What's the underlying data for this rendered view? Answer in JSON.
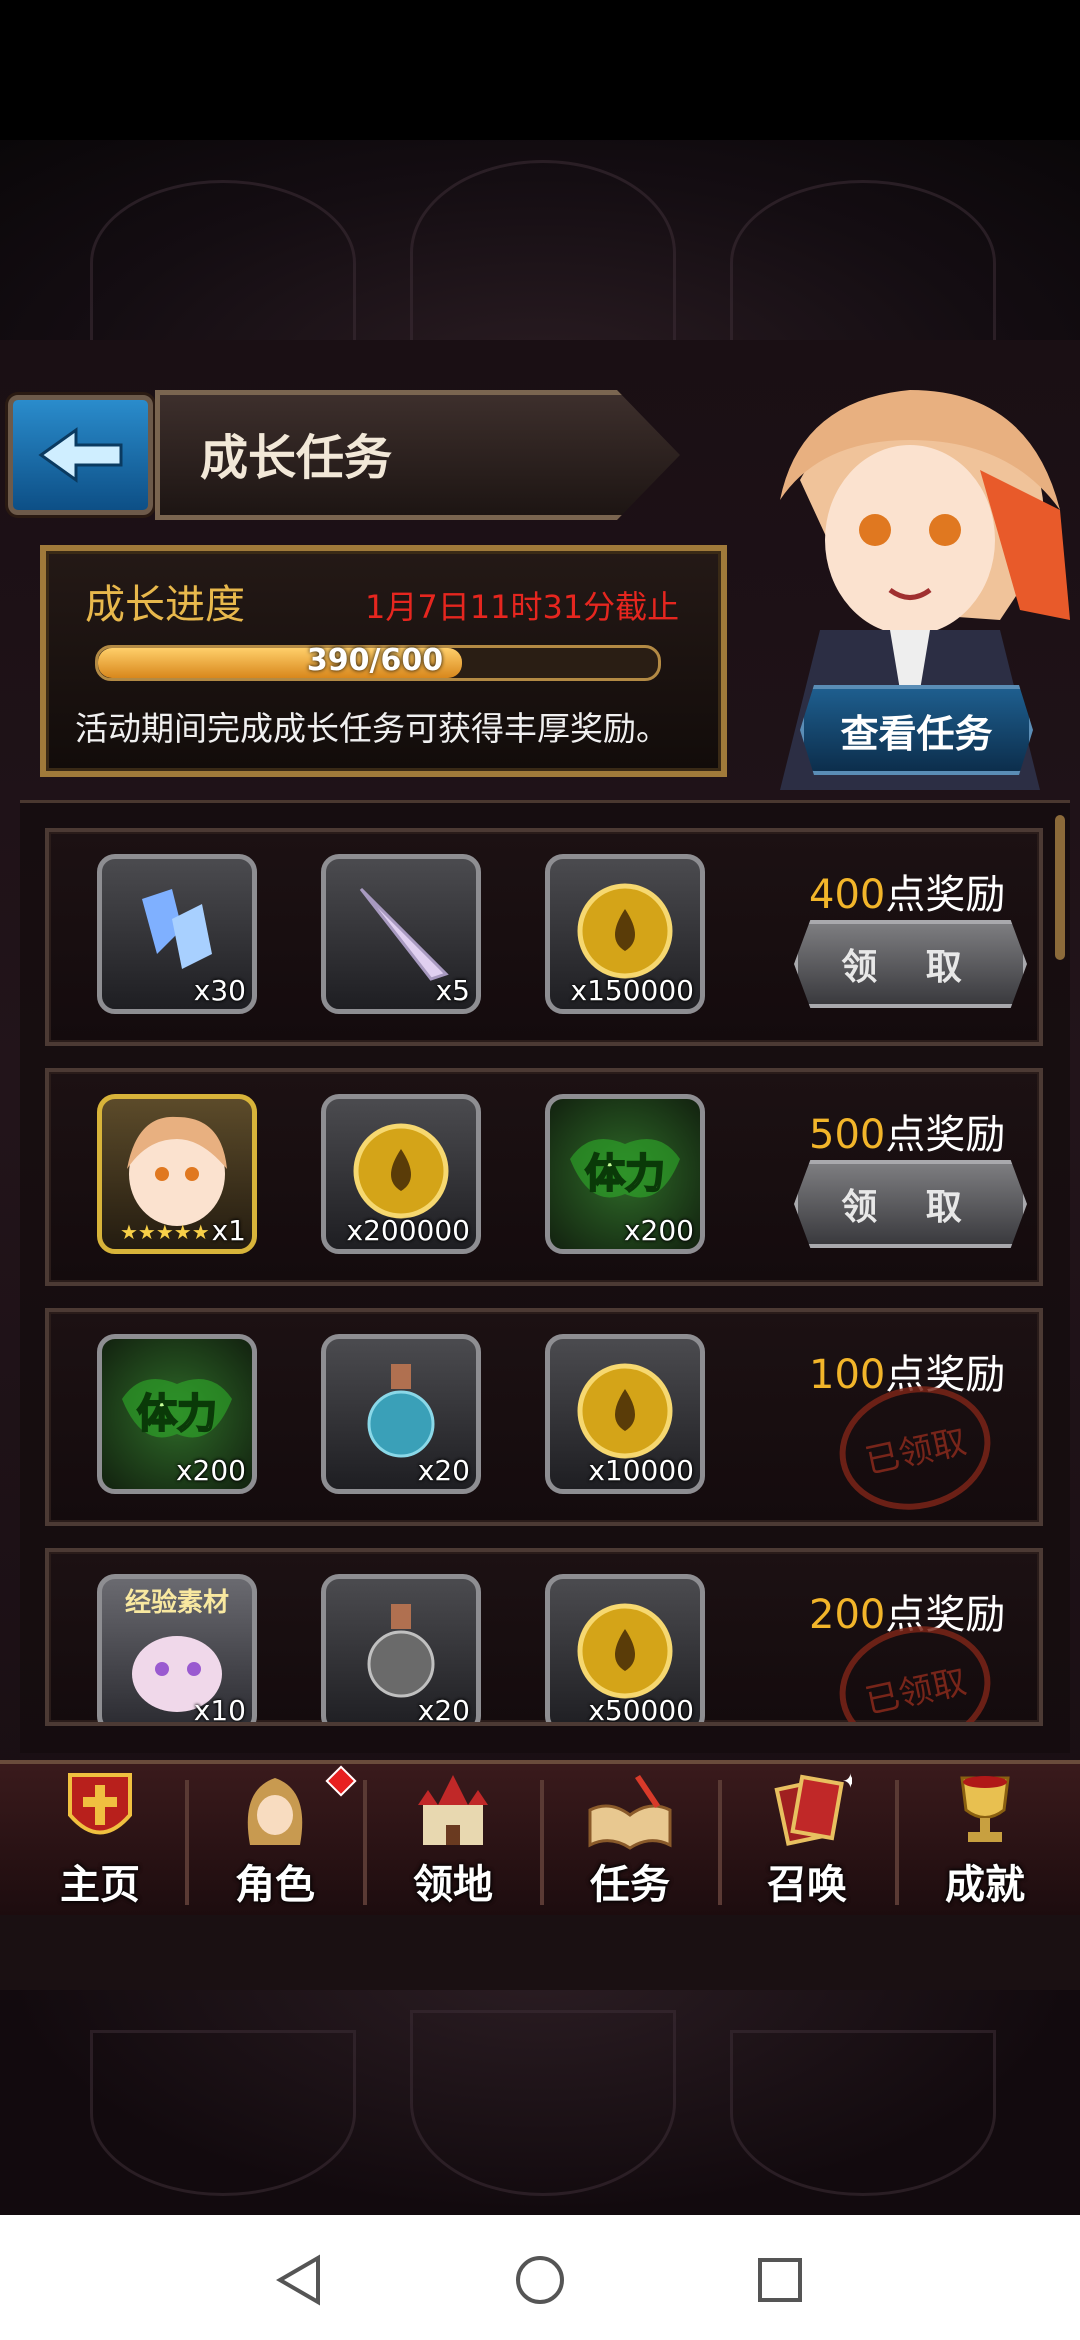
{
  "header": {
    "title": "成长任务"
  },
  "progress": {
    "label": "成长进度",
    "deadline": "1月7日11时31分截止",
    "current": 390,
    "max": 600,
    "text": "390/600",
    "fraction": 0.65,
    "description": "活动期间完成成长任务可获得丰厚奖励。"
  },
  "view_tasks_label": "查看任务",
  "rows": [
    {
      "points": "400",
      "points_suffix": "点奖励",
      "action": "领 取",
      "status": "claimable",
      "items": [
        {
          "icon": "crystal-icon",
          "qty": "x30"
        },
        {
          "icon": "horn-icon",
          "qty": "x5"
        },
        {
          "icon": "gold-coin-icon",
          "qty": "x150000"
        }
      ]
    },
    {
      "points": "500",
      "points_suffix": "点奖励",
      "action": "领 取",
      "status": "claimable",
      "items": [
        {
          "icon": "character-portrait-icon",
          "qty": "x1"
        },
        {
          "icon": "gold-coin-icon",
          "qty": "x200000"
        },
        {
          "icon": "stamina-icon",
          "qty": "x200",
          "label": "体力"
        }
      ]
    },
    {
      "points": "100",
      "points_suffix": "点奖励",
      "stamp": "已领取",
      "status": "claimed",
      "items": [
        {
          "icon": "stamina-icon",
          "qty": "x200",
          "label": "体力"
        },
        {
          "icon": "potion-icon",
          "qty": "x20"
        },
        {
          "icon": "gold-coin-icon",
          "qty": "x10000"
        }
      ]
    },
    {
      "points": "200",
      "points_suffix": "点奖励",
      "stamp": "已领取",
      "status": "claimed",
      "items": [
        {
          "icon": "exp-material-icon",
          "qty": "x10",
          "label": "经验素材"
        },
        {
          "icon": "potion-icon",
          "qty": "x20"
        },
        {
          "icon": "gold-coin-icon",
          "qty": "x50000"
        }
      ]
    }
  ],
  "nav": [
    {
      "label": "主页",
      "icon": "home-shield-icon"
    },
    {
      "label": "角色",
      "icon": "character-hood-icon"
    },
    {
      "label": "领地",
      "icon": "castle-icon"
    },
    {
      "label": "任务",
      "icon": "quest-book-icon"
    },
    {
      "label": "召唤",
      "icon": "summon-cards-icon"
    },
    {
      "label": "成就",
      "icon": "trophy-icon"
    }
  ],
  "colors": {
    "accent_gold": "#f2b52a",
    "deadline_red": "#e6261f",
    "blue_button": "#1e5e8e"
  }
}
